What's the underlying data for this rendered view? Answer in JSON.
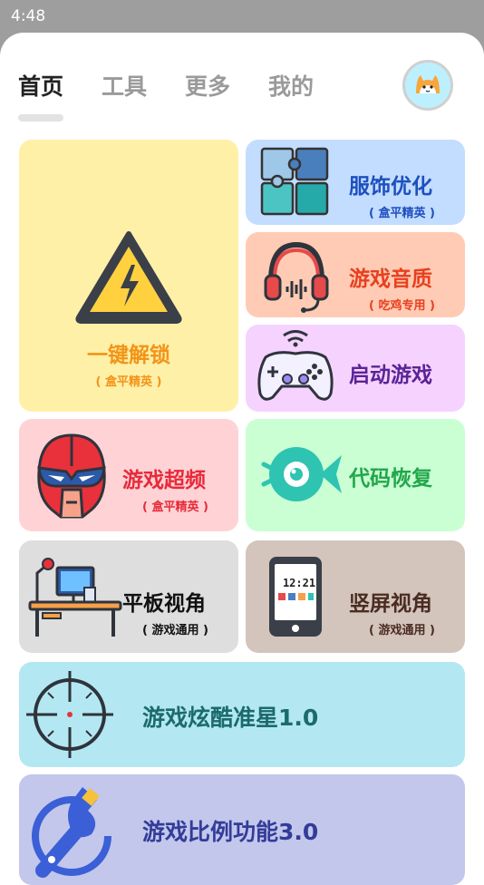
{
  "status": {
    "time": "4:48"
  },
  "tabs": [
    "首页",
    "工具",
    "更多",
    "我的"
  ],
  "cards": {
    "unlock": {
      "title": "一键解锁",
      "sub": "( 盒平精英 )",
      "bg": "#fff0a8",
      "color": "#f29418"
    },
    "outfit": {
      "title": "服饰优化",
      "sub": "( 盒平精英 )",
      "bg": "#c2ddff",
      "color": "#1f4fbf"
    },
    "audio": {
      "title": "游戏音质",
      "sub": "( 吃鸡专用 )",
      "bg": "#ffcbb4",
      "color": "#e8401f"
    },
    "launch": {
      "title": "启动游戏",
      "bg": "#f6d2ff",
      "color": "#5a2496"
    },
    "overclock": {
      "title": "游戏超频",
      "sub": "( 盒平精英 )",
      "bg": "#ffd3d5",
      "color": "#e72a3b"
    },
    "code": {
      "title": "代码恢复",
      "bg": "#c9ffd3",
      "color": "#23a64a"
    },
    "tablet": {
      "title": "平板视角",
      "sub": "( 游戏通用 )",
      "bg": "#dedede",
      "color": "#111111"
    },
    "portrait": {
      "title": "竖屏视角",
      "sub": "( 游戏通用 )",
      "bg": "#d3c4bc",
      "color": "#4a2c22"
    },
    "crosshair": {
      "title": "游戏炫酷准星1.0",
      "bg": "#b3e8f3",
      "color": "#1c6b6b"
    },
    "ratio": {
      "title": "游戏比例功能3.0",
      "bg": "#c3c7eb",
      "color": "#333c99"
    }
  },
  "icons": {
    "warning": "high-voltage-warning-icon",
    "puzzle": "puzzle-icon",
    "headset": "headset-icon",
    "gamepad": "gamepad-icon",
    "helmet": "superhero-helmet-icon",
    "fish": "fish-icon",
    "desk": "desk-computer-icon",
    "phone": "phone-clock-icon",
    "crosshair": "crosshair-icon",
    "wrench": "wrench-icon",
    "avatar": "cat-avatar-icon"
  },
  "phone_clock": "12:21"
}
